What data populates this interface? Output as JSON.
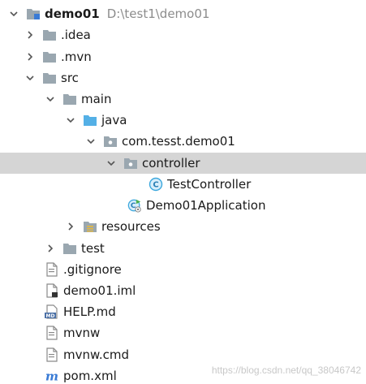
{
  "project": {
    "name": "demo01",
    "path": "D:\\test1\\demo01"
  },
  "tree": {
    "idea": ".idea",
    "mvn": ".mvn",
    "src": "src",
    "main": "main",
    "java": "java",
    "package": "com.tesst.demo01",
    "controller": "controller",
    "test_controller": "TestController",
    "application": "Demo01Application",
    "resources": "resources",
    "test": "test",
    "gitignore": ".gitignore",
    "iml": "demo01.iml",
    "help": "HELP.md",
    "mvnw": "mvnw",
    "mvnw_cmd": "mvnw.cmd",
    "pom": "pom.xml"
  },
  "icons": {
    "folder_color": "#9aa7b0",
    "source_folder_color": "#54b0e6",
    "class_color": "#3ba7dd",
    "maven_color": "#3a7bd5",
    "selected_bg": "#d5d5d5"
  },
  "watermark": "https://blog.csdn.net/qq_38046742"
}
